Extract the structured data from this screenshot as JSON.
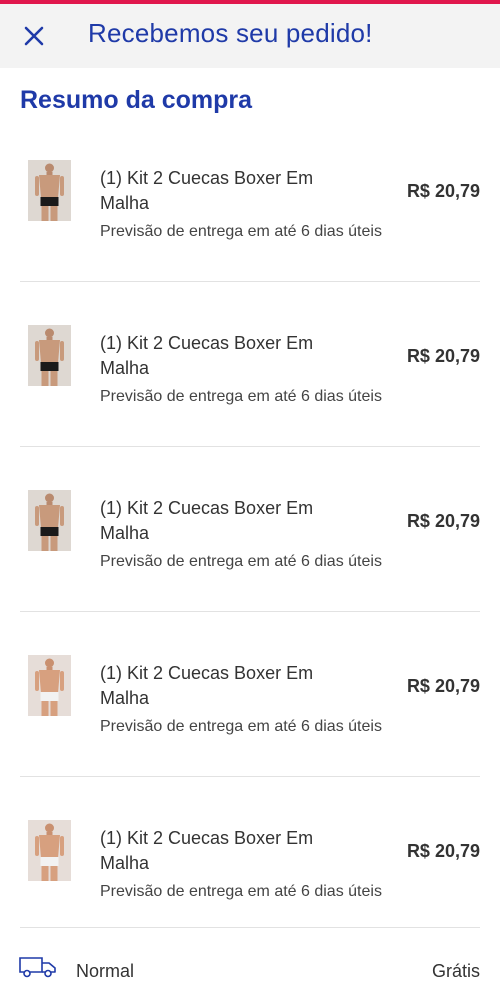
{
  "header": {
    "title": "Recebemos seu pedido!"
  },
  "summary": {
    "title": "Resumo da compra"
  },
  "items": [
    {
      "name": "(1) Kit 2 Cuecas Boxer Em Malha",
      "eta": "Previsão de entrega em até 6 dias úteis",
      "price": "R$ 20,79",
      "underwear_color": "#1a1a1a"
    },
    {
      "name": "(1) Kit 2 Cuecas Boxer Em Malha",
      "eta": "Previsão de entrega em até 6 dias úteis",
      "price": "R$ 20,79",
      "underwear_color": "#1a1a1a"
    },
    {
      "name": "(1) Kit 2 Cuecas Boxer Em Malha",
      "eta": "Previsão de entrega em até 6 dias úteis",
      "price": "R$ 20,79",
      "underwear_color": "#1a1a1a"
    },
    {
      "name": "(1) Kit 2 Cuecas Boxer Em Malha",
      "eta": "Previsão de entrega em até 6 dias úteis",
      "price": "R$ 20,79",
      "underwear_color": "#f2f2f2"
    },
    {
      "name": "(1) Kit 2 Cuecas Boxer Em Malha",
      "eta": "Previsão de entrega em até 6 dias úteis",
      "price": "R$ 20,79",
      "underwear_color": "#f2f2f2"
    }
  ],
  "shipping": {
    "label": "Normal",
    "value": "Grátis",
    "icon": "truck-icon"
  },
  "colors": {
    "brand_blue": "#1f3aa8",
    "accent_red": "#e0174c"
  }
}
